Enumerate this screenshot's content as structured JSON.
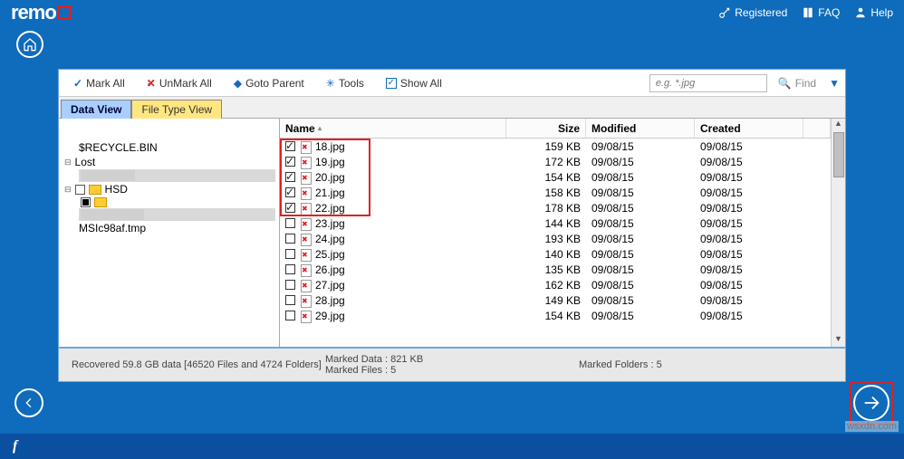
{
  "brand": "remo",
  "topbar": {
    "registered": "Registered",
    "faq": "FAQ",
    "help": "Help"
  },
  "toolbar": {
    "mark_all": "Mark All",
    "unmark_all": "UnMark All",
    "goto_parent": "Goto Parent",
    "tools": "Tools",
    "show_all": "Show All",
    "search_placeholder": "e.g. *.jpg",
    "find": "Find"
  },
  "tabs": {
    "data_view": "Data View",
    "file_type_view": "File Type View"
  },
  "columns": {
    "name": "Name",
    "size": "Size",
    "modified": "Modified",
    "created": "Created"
  },
  "tree": {
    "recycle": "$RECYCLE.BIN",
    "lost": "Lost",
    "hsd": "HSD",
    "msic": "MSIc98af.tmp"
  },
  "files": [
    {
      "checked": true,
      "name": "18.jpg",
      "size": "159 KB",
      "modified": "09/08/15",
      "created": "09/08/15"
    },
    {
      "checked": true,
      "name": "19.jpg",
      "size": "172 KB",
      "modified": "09/08/15",
      "created": "09/08/15"
    },
    {
      "checked": true,
      "name": "20.jpg",
      "size": "154 KB",
      "modified": "09/08/15",
      "created": "09/08/15"
    },
    {
      "checked": true,
      "name": "21.jpg",
      "size": "158 KB",
      "modified": "09/08/15",
      "created": "09/08/15"
    },
    {
      "checked": true,
      "name": "22.jpg",
      "size": "178 KB",
      "modified": "09/08/15",
      "created": "09/08/15"
    },
    {
      "checked": false,
      "name": "23.jpg",
      "size": "144 KB",
      "modified": "09/08/15",
      "created": "09/08/15"
    },
    {
      "checked": false,
      "name": "24.jpg",
      "size": "193 KB",
      "modified": "09/08/15",
      "created": "09/08/15"
    },
    {
      "checked": false,
      "name": "25.jpg",
      "size": "140 KB",
      "modified": "09/08/15",
      "created": "09/08/15"
    },
    {
      "checked": false,
      "name": "26.jpg",
      "size": "135 KB",
      "modified": "09/08/15",
      "created": "09/08/15"
    },
    {
      "checked": false,
      "name": "27.jpg",
      "size": "162 KB",
      "modified": "09/08/15",
      "created": "09/08/15"
    },
    {
      "checked": false,
      "name": "28.jpg",
      "size": "149 KB",
      "modified": "09/08/15",
      "created": "09/08/15"
    },
    {
      "checked": false,
      "name": "29.jpg",
      "size": "154 KB",
      "modified": "09/08/15",
      "created": "09/08/15"
    }
  ],
  "status": {
    "recovered": "Recovered 59.8 GB data [46520 Files and 4724 Folders]",
    "marked_data": "Marked Data : 821 KB",
    "marked_files": "Marked Files : 5",
    "marked_folders": "Marked Folders : 5"
  },
  "attribution": "wsxdn.com"
}
